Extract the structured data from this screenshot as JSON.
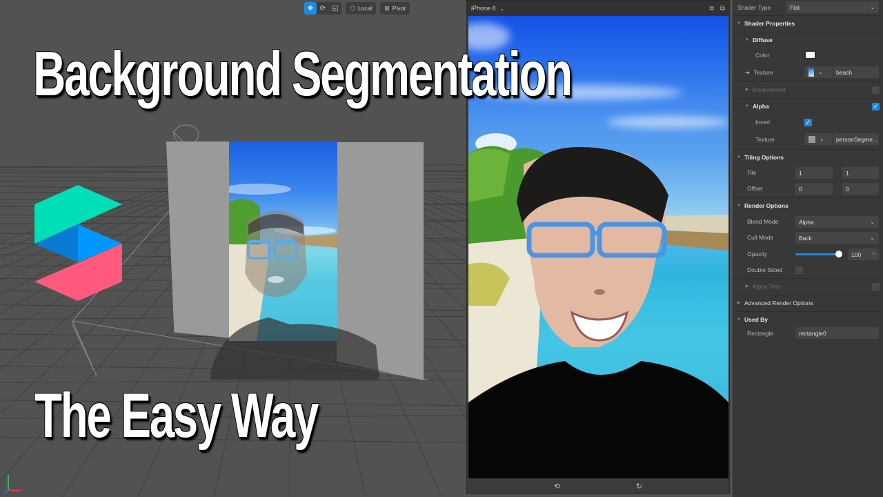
{
  "viewport": {
    "toolbar": {
      "tools": [
        {
          "name": "move-tool",
          "glyph": "✥",
          "active": true
        },
        {
          "name": "rotate-tool",
          "glyph": "⟳",
          "active": false
        },
        {
          "name": "scale-tool",
          "glyph": "◱",
          "active": false
        }
      ],
      "space_label": "Local",
      "space_icon": "⬡",
      "pivot_label": "Pivot",
      "pivot_icon": "⊠"
    }
  },
  "thumbnail": {
    "title": "Background Segmentation",
    "subtitle": "The Easy Way"
  },
  "logo": {
    "colors": {
      "top": "#00dfb6",
      "middle_left": "#0a7bd4",
      "middle_right": "#0098ff",
      "bottom": "#ff5a7e"
    }
  },
  "simulator": {
    "device": "iPhone 8",
    "header_icons": [
      "menu-icon",
      "pop-out-icon"
    ],
    "footer_icons": [
      "switch-camera-icon",
      "rotate-device-icon"
    ]
  },
  "inspector": {
    "shader_type": {
      "label": "Shader Type",
      "value": "Flat"
    },
    "shader_properties": {
      "label": "Shader Properties"
    },
    "diffuse": {
      "label": "Diffuse",
      "color_label": "Color",
      "color_value": "#ffffff",
      "texture_label": "Texture",
      "texture_value": "beach"
    },
    "environment": {
      "label": "Environment",
      "enabled": false
    },
    "alpha": {
      "label": "Alpha",
      "enabled": true,
      "invert_label": "Invert",
      "invert": true,
      "texture_label": "Texture",
      "texture_value": "personSegme..."
    },
    "tiling": {
      "label": "Tiling Options",
      "tile_label": "Tile",
      "tile_x": "1",
      "tile_y": "1",
      "offset_label": "Offset",
      "offset_x": "0",
      "offset_y": "0"
    },
    "render": {
      "label": "Render Options",
      "blend_mode_label": "Blend Mode",
      "blend_mode": "Alpha",
      "cull_mode_label": "Cull Mode",
      "cull_mode": "Back",
      "opacity_label": "Opacity",
      "opacity": "100",
      "opacity_unit": "%",
      "opacity_fraction": 1.0,
      "double_sided_label": "Double Sided",
      "double_sided": false,
      "alpha_test_label": "Alpha Test",
      "alpha_test": false
    },
    "advanced": {
      "label": "Advanced Render Options"
    },
    "used_by": {
      "label": "Used By",
      "object_label": "Rectangle",
      "object_value": "rectangle0"
    },
    "accent": "#1e88e5"
  }
}
